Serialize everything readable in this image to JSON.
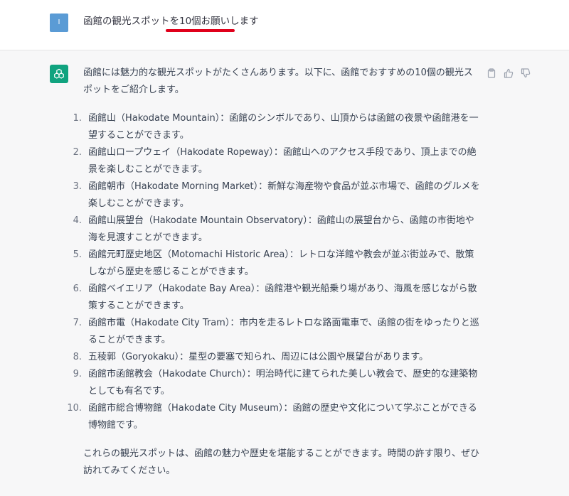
{
  "user": {
    "avatar_initial": "I",
    "message": "函館の観光スポットを10個お願いします"
  },
  "assistant": {
    "intro": "函館には魅力的な観光スポットがたくさんあります。以下に、函館でおすすめの10個の観光スポットをご紹介します。",
    "items": [
      {
        "num": "1.",
        "text": "函館山（Hakodate Mountain）：函館のシンボルであり、山頂からは函館の夜景や函館港を一望することができます。"
      },
      {
        "num": "2.",
        "text": "函館山ロープウェイ（Hakodate Ropeway）：函館山へのアクセス手段であり、頂上までの絶景を楽しむことができます。"
      },
      {
        "num": "3.",
        "text": "函館朝市（Hakodate Morning Market）：新鮮な海産物や食品が並ぶ市場で、函館のグルメを楽しむことができます。"
      },
      {
        "num": "4.",
        "text": "函館山展望台（Hakodate Mountain Observatory）：函館山の展望台から、函館の市街地や海を見渡すことができます。"
      },
      {
        "num": "5.",
        "text": "函館元町歴史地区（Motomachi Historic Area）：レトロな洋館や教会が並ぶ街並みで、散策しながら歴史を感じることができます。"
      },
      {
        "num": "6.",
        "text": "函館ベイエリア（Hakodate Bay Area）：函館港や観光船乗り場があり、海風を感じながら散策することができます。"
      },
      {
        "num": "7.",
        "text": "函館市電（Hakodate City Tram）：市内を走るレトロな路面電車で、函館の街をゆったりと巡ることができます。"
      },
      {
        "num": "8.",
        "text": "五稜郭（Goryokaku）：星型の要塞で知られ、周辺には公園や展望台があります。"
      },
      {
        "num": "9.",
        "text": "函館市函館教会（Hakodate Church）：明治時代に建てられた美しい教会で、歴史的な建築物としても有名です。"
      },
      {
        "num": "10.",
        "text": "函館市総合博物館（Hakodate City Museum）：函館の歴史や文化について学ぶことができる博物館です。"
      }
    ],
    "outro": "これらの観光スポットは、函館の魅力や歴史を堪能することができます。時間の許す限り、ぜひ訪れてみてください。"
  },
  "icons": {
    "copy": "clipboard-icon",
    "like": "thumbs-up-icon",
    "dislike": "thumbs-down-icon",
    "assistant_logo": "openai-logo-icon"
  },
  "colors": {
    "assistant_logo_bg": "#10a37f",
    "user_avatar_bg": "#5a9bd5",
    "underline_annotation": "#e0001b"
  }
}
